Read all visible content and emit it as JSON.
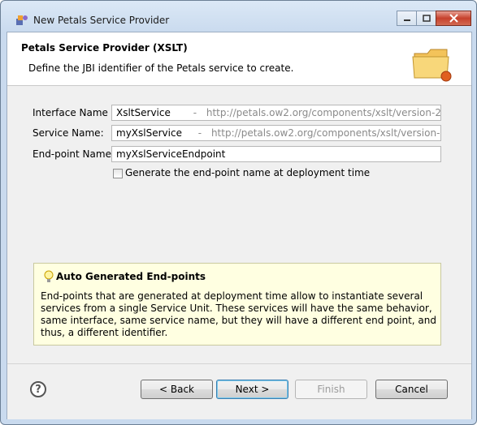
{
  "window": {
    "title": "New Petals Service Provider",
    "controls": {
      "minimize": "minimize",
      "maximize": "maximize",
      "close": "close"
    }
  },
  "header": {
    "title": "Petals Service Provider (XSLT)",
    "description": "Define the JBI identifier of the Petals service to create."
  },
  "form": {
    "interface": {
      "label": "Interface Name *:",
      "name": "XsltService",
      "separator": "-",
      "namespace": "http://petals.ow2.org/components/xslt/version-2"
    },
    "service": {
      "label": "Service Name:",
      "name": "myXslService",
      "separator": "-",
      "namespace": "http://petals.ow2.org/components/xslt/version-2"
    },
    "endpoint": {
      "label": "End-point Name:",
      "value": "myXslServiceEndpoint"
    },
    "generate_checkbox": {
      "label": "Generate the end-point name at deployment time",
      "checked": false
    }
  },
  "info": {
    "title": "Auto Generated End-points",
    "body": "End-points that are generated at deployment time allow to instantiate several services from a single Service Unit. These services will have the same behavior, same interface, same service name, but they will have a different end point, and thus, a different identifier."
  },
  "footer": {
    "help": "?",
    "back": "< Back",
    "next": "Next >",
    "finish": "Finish",
    "cancel": "Cancel"
  }
}
